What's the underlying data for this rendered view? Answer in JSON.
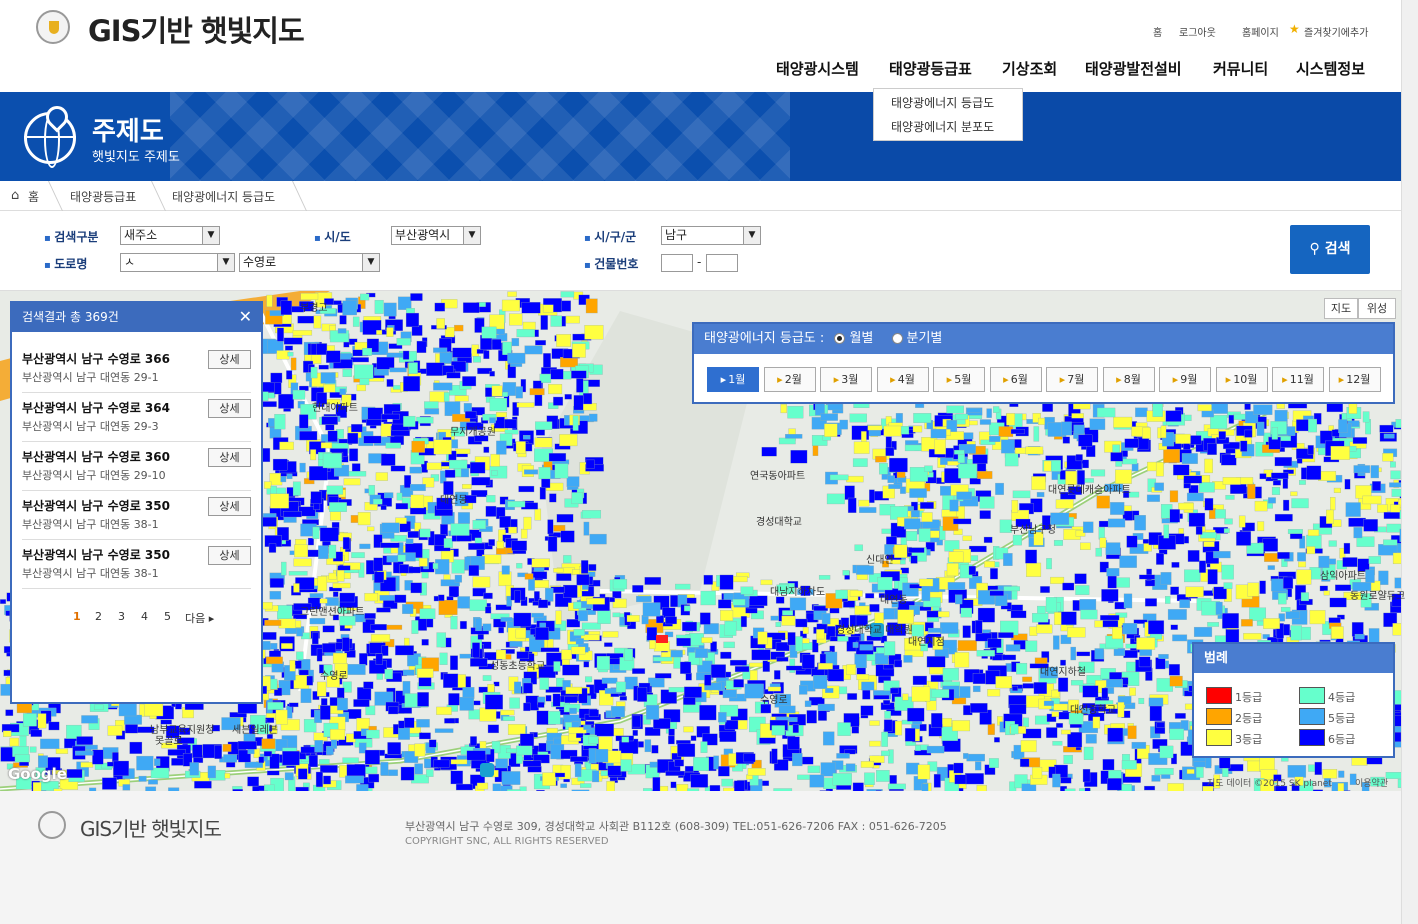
{
  "header": {
    "title": "GIS기반 햇빛지도",
    "util": [
      "홈",
      "로그아웃",
      "홈페이지",
      "즐겨찾기에추가"
    ],
    "menu": [
      "태양광시스템",
      "태양광등급표",
      "기상조회",
      "태양광발전설비",
      "커뮤니티",
      "시스템정보"
    ],
    "submenu": [
      "태양광에너지 등급도",
      "태양광에너지 분포도"
    ]
  },
  "banner": {
    "title": "주제도",
    "subtitle": "햇빛지도 주제도"
  },
  "breadcrumb": [
    "홈",
    "태양광등급표",
    "태양광에너지 등급도"
  ],
  "search": {
    "labels": {
      "type": "검색구분",
      "sido": "시/도",
      "sigungu": "시/구/군",
      "road": "도로명",
      "bldg": "건물번호"
    },
    "type": "새주소",
    "sido": "부산광역시",
    "sigungu": "남구",
    "road_initial": "ㅅ",
    "road": "수영로",
    "bldg_sep": "-",
    "button": "검색"
  },
  "results": {
    "title": "검색결과 총 369건",
    "detail": "상세",
    "items": [
      {
        "road": "부산광역시 남구 수영로 366",
        "jibun": "부산광역시 남구 대연동 29-1"
      },
      {
        "road": "부산광역시 남구 수영로 364",
        "jibun": "부산광역시 남구 대연동 29-3"
      },
      {
        "road": "부산광역시 남구 수영로 360",
        "jibun": "부산광역시 남구 대연동 29-10"
      },
      {
        "road": "부산광역시 남구 수영로 350",
        "jibun": "부산광역시 남구 대연동 38-1"
      },
      {
        "road": "부산광역시 남구 수영로 350",
        "jibun": "부산광역시 남구 대연동 38-1"
      }
    ],
    "pages": [
      "1",
      "2",
      "3",
      "4",
      "5"
    ],
    "next": "다음"
  },
  "grade_panel": {
    "title": "태양광에너지 등급도 :",
    "modes": [
      "월별",
      "분기별"
    ],
    "selected_mode": "월별",
    "months": [
      "1월",
      "2월",
      "3월",
      "4월",
      "5월",
      "6월",
      "7월",
      "8월",
      "9월",
      "10월",
      "11월",
      "12월"
    ],
    "selected_month": "1월"
  },
  "legend": {
    "title": "범례",
    "grades": [
      {
        "label": "1등급",
        "color": "#ff0000"
      },
      {
        "label": "2등급",
        "color": "#ffa500"
      },
      {
        "label": "3등급",
        "color": "#ffff40"
      },
      {
        "label": "4등급",
        "color": "#66ffcc"
      },
      {
        "label": "5등급",
        "color": "#3fa9f5"
      },
      {
        "label": "6등급",
        "color": "#0000ff"
      }
    ]
  },
  "map": {
    "types": [
      "지도",
      "위성"
    ],
    "attribution": "지도 데이터 ©2015 SK planet",
    "terms": "이용약관",
    "google": "Google",
    "labels": [
      "부경고",
      "현대아파트",
      "무지개공원",
      "그린맨션아파트",
      "대연동",
      "연국동아파트",
      "경성대학교",
      "신대연",
      "대연롯데캐슬아파트",
      "대남지하차도",
      "경성대학교 대학원",
      "부산남구청",
      "대연지점",
      "수영로",
      "대연지하철",
      "대천중학교",
      "성동초등학교",
      "삼익아파트",
      "동원로얄듀크",
      "수영로",
      "대연동",
      "남부교육지원청",
      "못골로",
      "세븐일레븐"
    ]
  },
  "footer": {
    "logo": "GIS기반 햇빛지도",
    "address": "부산광역시 남구 수영로 309, 경성대학교 사회관 B112호 (608-309) TEL:051-626-7206 FAX : 051-626-7205",
    "copyright": "COPYRIGHT SNC, ALL RIGHTS RESERVED"
  }
}
